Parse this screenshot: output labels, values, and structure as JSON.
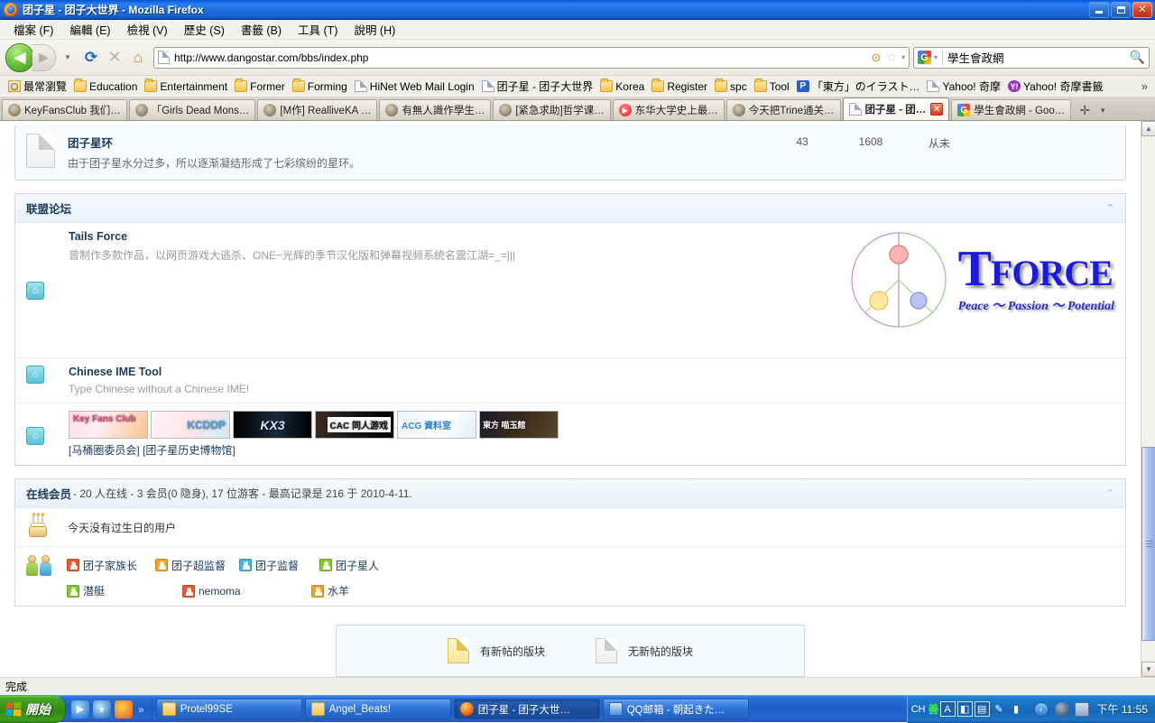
{
  "window": {
    "title": "团子星 - 团子大世界 - Mozilla Firefox",
    "minimize_label": "–",
    "maximize_label": "❐",
    "close_label": "✕"
  },
  "menubar": {
    "items": [
      {
        "label": "檔案 (F)"
      },
      {
        "label": "編輯 (E)"
      },
      {
        "label": "檢視 (V)"
      },
      {
        "label": "歷史 (S)"
      },
      {
        "label": "書籤 (B)"
      },
      {
        "label": "工具 (T)"
      },
      {
        "label": "說明 (H)"
      }
    ]
  },
  "toolbar": {
    "back_glyph": "◀",
    "forward_glyph": "▶",
    "dropdown_glyph": "▾",
    "reload_glyph": "⟳",
    "stop_glyph": "✕",
    "home_glyph": "⌂",
    "url": "http://www.dangostar.com/bbs/index.php",
    "url_placeholder": "輸入網址",
    "rss_glyph": "⊙",
    "star_glyph": "☆",
    "chevron_glyph": "▾",
    "search_value": "學生會政網",
    "search_placeholder": "搜尋",
    "search_glyph": "🔍"
  },
  "bookmarks": {
    "items": [
      {
        "label": "最常瀏覽",
        "icon": "history-icon"
      },
      {
        "label": "Education",
        "icon": "folder-icon"
      },
      {
        "label": "Entertainment",
        "icon": "folder-icon"
      },
      {
        "label": "Former",
        "icon": "folder-icon"
      },
      {
        "label": "Forming",
        "icon": "folder-icon"
      },
      {
        "label": "HiNet Web Mail Login",
        "icon": "page-icon"
      },
      {
        "label": "团子星 - 团子大世界",
        "icon": "page-icon"
      },
      {
        "label": "Korea",
        "icon": "folder-icon"
      },
      {
        "label": "Register",
        "icon": "folder-icon"
      },
      {
        "label": "spc",
        "icon": "folder-icon"
      },
      {
        "label": "Tool",
        "icon": "folder-icon"
      },
      {
        "label": "「東方」のイラスト…",
        "icon": "pixiv-icon"
      },
      {
        "label": "Yahoo! 奇摩",
        "icon": "page-icon"
      },
      {
        "label": "Yahoo! 奇摩書籤",
        "icon": "yahoo-bookmark-icon"
      }
    ],
    "overflow_glyph": "»"
  },
  "tabs": {
    "items": [
      {
        "label": "KeyFansClub 我们…",
        "favicon": "anon-icon",
        "active": false
      },
      {
        "label": "「Girls Dead Mons…",
        "favicon": "anon-icon",
        "active": false
      },
      {
        "label": "[M作] RealliveKA …",
        "favicon": "anon-icon",
        "active": false
      },
      {
        "label": "有無人識作學生…",
        "favicon": "anon-icon",
        "active": false
      },
      {
        "label": "[紧急求助]哲学课…",
        "favicon": "anon-icon",
        "active": false
      },
      {
        "label": "东华大学史上最…",
        "favicon": "play-icon",
        "active": false
      },
      {
        "label": "今天把Trine通关…",
        "favicon": "anon-icon",
        "active": false
      },
      {
        "label": "团子星 - 团…",
        "favicon": "page-icon",
        "active": true,
        "close_label": "✕"
      },
      {
        "label": "學生會政網 - Goo…",
        "favicon": "google-icon",
        "active": false
      }
    ],
    "new_tab_glyph": "✛",
    "list_glyph": "▾"
  },
  "page": {
    "forum_row": {
      "title": "团子星环",
      "description": "由于团子星水分过多，所以逐渐凝结形成了七彩缤纷的星环。",
      "topics": "43",
      "posts": "1608",
      "last_post": "从未"
    },
    "ally_section": {
      "heading": "联盟论坛",
      "collapse_glyph": "⌃",
      "entries": [
        {
          "name": "Tails Force",
          "description": "曾制作多款作品，以网页游戏大逃杀、ONE~光辉的季节汉化版和弹幕视频系统名震江湖=_=|||",
          "home_glyph": "⌂",
          "logo": {
            "word_first": "T",
            "word_rest": "FORCE",
            "tagline": "Peace ～ Passion ～ Potential"
          }
        },
        {
          "name": "Chinese IME Tool",
          "description": "Type Chinese without a Chinese IME!",
          "home_glyph": "⌂"
        }
      ],
      "banner_row": {
        "home_glyph": "⌂",
        "banners": [
          {
            "label": "Key Fans Club",
            "style": "b1"
          },
          {
            "label": "KCDDP",
            "style": "b2"
          },
          {
            "label": "KX3",
            "style": "b3"
          },
          {
            "label": "CAC 同人游戏",
            "style": "b4"
          },
          {
            "label": "ACG 資料室",
            "style": "b5"
          },
          {
            "label": "東方 喵玉館",
            "style": "b6"
          }
        ],
        "links_line": "[马桶圈委员会] [团子星历史博物馆]"
      }
    },
    "online_section": {
      "heading": "在线会员",
      "summary": "- 20 人在线 - 3 会员(0 隐身), 17 位游客 - 最高记录是 216 于 2010-4-11.",
      "collapse_glyph": "⌃",
      "birthday_text": "今天没有过生日的用户",
      "members_row_1": [
        {
          "name": "团子家族长",
          "color": "#f0552b"
        },
        {
          "name": "团子超监督",
          "color": "#f0a32b"
        },
        {
          "name": "团子监督",
          "color": "#42b8e0"
        },
        {
          "name": "团子星人",
          "color": "#7fc832"
        }
      ],
      "members_row_2": [
        {
          "name": "潜艇",
          "color": "#7fc832"
        },
        {
          "name": "nemoma",
          "color": "#f0552b"
        },
        {
          "name": "水羊",
          "color": "#f0a32b"
        }
      ]
    },
    "legend": {
      "items": [
        {
          "label": "有新帖的版块",
          "icon": "new-post-doc-icon",
          "style": "yellow"
        },
        {
          "label": "无新帖的版块",
          "icon": "no-new-post-doc-icon",
          "style": "grey"
        }
      ]
    }
  },
  "scrollbar": {
    "up_glyph": "▲",
    "down_glyph": "▼"
  },
  "statusbar": {
    "text": "完成"
  },
  "taskbar": {
    "start_label": "開始",
    "quicklaunch": [
      {
        "name": "media-player-icon",
        "glyph": "▶"
      },
      {
        "name": "internet-explorer-icon",
        "glyph": "e"
      },
      {
        "name": "firefox-icon",
        "glyph": ""
      }
    ],
    "quicklaunch_more_glyph": "»",
    "tasks": [
      {
        "label": "Protel99SE",
        "icon": "folder-icon",
        "active": false
      },
      {
        "label": "Angel_Beats!",
        "icon": "folder-icon",
        "active": false
      },
      {
        "label": "团子星 - 团子大世…",
        "icon": "firefox-icon",
        "active": true
      },
      {
        "label": "QQ邮箱 - 朝起きた…",
        "icon": "qq-icon",
        "active": false
      }
    ],
    "tray": {
      "ime_lang": "CH",
      "ime_mode": "善",
      "ime_cells": [
        "A",
        "◧",
        "▤"
      ],
      "ime_extra": [
        "✎",
        "▮"
      ],
      "arrow_glyph": "‹",
      "clock": "下午 11:55"
    }
  }
}
